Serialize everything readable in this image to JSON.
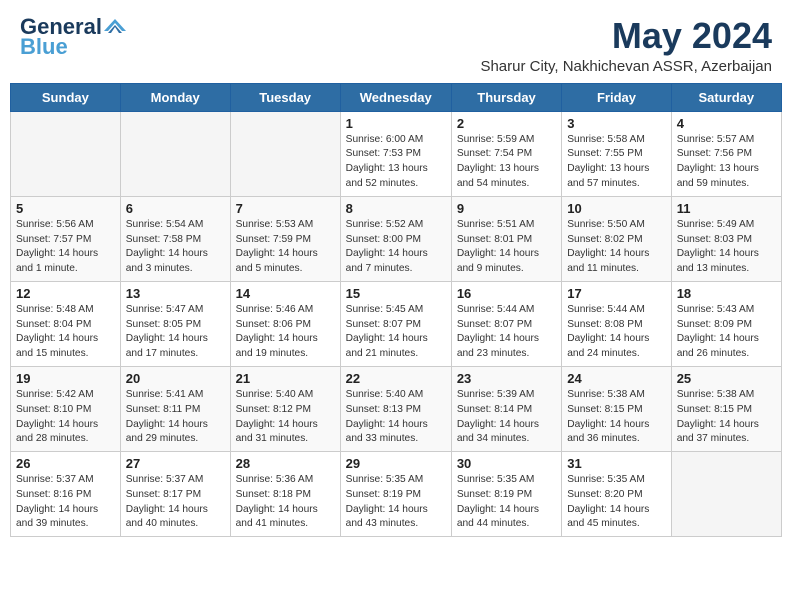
{
  "header": {
    "logo_line1": "General",
    "logo_line2": "Blue",
    "month": "May 2024",
    "location": "Sharur City, Nakhichevan ASSR, Azerbaijan"
  },
  "weekdays": [
    "Sunday",
    "Monday",
    "Tuesday",
    "Wednesday",
    "Thursday",
    "Friday",
    "Saturday"
  ],
  "weeks": [
    [
      {
        "day": "",
        "info": ""
      },
      {
        "day": "",
        "info": ""
      },
      {
        "day": "",
        "info": ""
      },
      {
        "day": "1",
        "info": "Sunrise: 6:00 AM\nSunset: 7:53 PM\nDaylight: 13 hours\nand 52 minutes."
      },
      {
        "day": "2",
        "info": "Sunrise: 5:59 AM\nSunset: 7:54 PM\nDaylight: 13 hours\nand 54 minutes."
      },
      {
        "day": "3",
        "info": "Sunrise: 5:58 AM\nSunset: 7:55 PM\nDaylight: 13 hours\nand 57 minutes."
      },
      {
        "day": "4",
        "info": "Sunrise: 5:57 AM\nSunset: 7:56 PM\nDaylight: 13 hours\nand 59 minutes."
      }
    ],
    [
      {
        "day": "5",
        "info": "Sunrise: 5:56 AM\nSunset: 7:57 PM\nDaylight: 14 hours\nand 1 minute."
      },
      {
        "day": "6",
        "info": "Sunrise: 5:54 AM\nSunset: 7:58 PM\nDaylight: 14 hours\nand 3 minutes."
      },
      {
        "day": "7",
        "info": "Sunrise: 5:53 AM\nSunset: 7:59 PM\nDaylight: 14 hours\nand 5 minutes."
      },
      {
        "day": "8",
        "info": "Sunrise: 5:52 AM\nSunset: 8:00 PM\nDaylight: 14 hours\nand 7 minutes."
      },
      {
        "day": "9",
        "info": "Sunrise: 5:51 AM\nSunset: 8:01 PM\nDaylight: 14 hours\nand 9 minutes."
      },
      {
        "day": "10",
        "info": "Sunrise: 5:50 AM\nSunset: 8:02 PM\nDaylight: 14 hours\nand 11 minutes."
      },
      {
        "day": "11",
        "info": "Sunrise: 5:49 AM\nSunset: 8:03 PM\nDaylight: 14 hours\nand 13 minutes."
      }
    ],
    [
      {
        "day": "12",
        "info": "Sunrise: 5:48 AM\nSunset: 8:04 PM\nDaylight: 14 hours\nand 15 minutes."
      },
      {
        "day": "13",
        "info": "Sunrise: 5:47 AM\nSunset: 8:05 PM\nDaylight: 14 hours\nand 17 minutes."
      },
      {
        "day": "14",
        "info": "Sunrise: 5:46 AM\nSunset: 8:06 PM\nDaylight: 14 hours\nand 19 minutes."
      },
      {
        "day": "15",
        "info": "Sunrise: 5:45 AM\nSunset: 8:07 PM\nDaylight: 14 hours\nand 21 minutes."
      },
      {
        "day": "16",
        "info": "Sunrise: 5:44 AM\nSunset: 8:07 PM\nDaylight: 14 hours\nand 23 minutes."
      },
      {
        "day": "17",
        "info": "Sunrise: 5:44 AM\nSunset: 8:08 PM\nDaylight: 14 hours\nand 24 minutes."
      },
      {
        "day": "18",
        "info": "Sunrise: 5:43 AM\nSunset: 8:09 PM\nDaylight: 14 hours\nand 26 minutes."
      }
    ],
    [
      {
        "day": "19",
        "info": "Sunrise: 5:42 AM\nSunset: 8:10 PM\nDaylight: 14 hours\nand 28 minutes."
      },
      {
        "day": "20",
        "info": "Sunrise: 5:41 AM\nSunset: 8:11 PM\nDaylight: 14 hours\nand 29 minutes."
      },
      {
        "day": "21",
        "info": "Sunrise: 5:40 AM\nSunset: 8:12 PM\nDaylight: 14 hours\nand 31 minutes."
      },
      {
        "day": "22",
        "info": "Sunrise: 5:40 AM\nSunset: 8:13 PM\nDaylight: 14 hours\nand 33 minutes."
      },
      {
        "day": "23",
        "info": "Sunrise: 5:39 AM\nSunset: 8:14 PM\nDaylight: 14 hours\nand 34 minutes."
      },
      {
        "day": "24",
        "info": "Sunrise: 5:38 AM\nSunset: 8:15 PM\nDaylight: 14 hours\nand 36 minutes."
      },
      {
        "day": "25",
        "info": "Sunrise: 5:38 AM\nSunset: 8:15 PM\nDaylight: 14 hours\nand 37 minutes."
      }
    ],
    [
      {
        "day": "26",
        "info": "Sunrise: 5:37 AM\nSunset: 8:16 PM\nDaylight: 14 hours\nand 39 minutes."
      },
      {
        "day": "27",
        "info": "Sunrise: 5:37 AM\nSunset: 8:17 PM\nDaylight: 14 hours\nand 40 minutes."
      },
      {
        "day": "28",
        "info": "Sunrise: 5:36 AM\nSunset: 8:18 PM\nDaylight: 14 hours\nand 41 minutes."
      },
      {
        "day": "29",
        "info": "Sunrise: 5:35 AM\nSunset: 8:19 PM\nDaylight: 14 hours\nand 43 minutes."
      },
      {
        "day": "30",
        "info": "Sunrise: 5:35 AM\nSunset: 8:19 PM\nDaylight: 14 hours\nand 44 minutes."
      },
      {
        "day": "31",
        "info": "Sunrise: 5:35 AM\nSunset: 8:20 PM\nDaylight: 14 hours\nand 45 minutes."
      },
      {
        "day": "",
        "info": ""
      }
    ]
  ]
}
